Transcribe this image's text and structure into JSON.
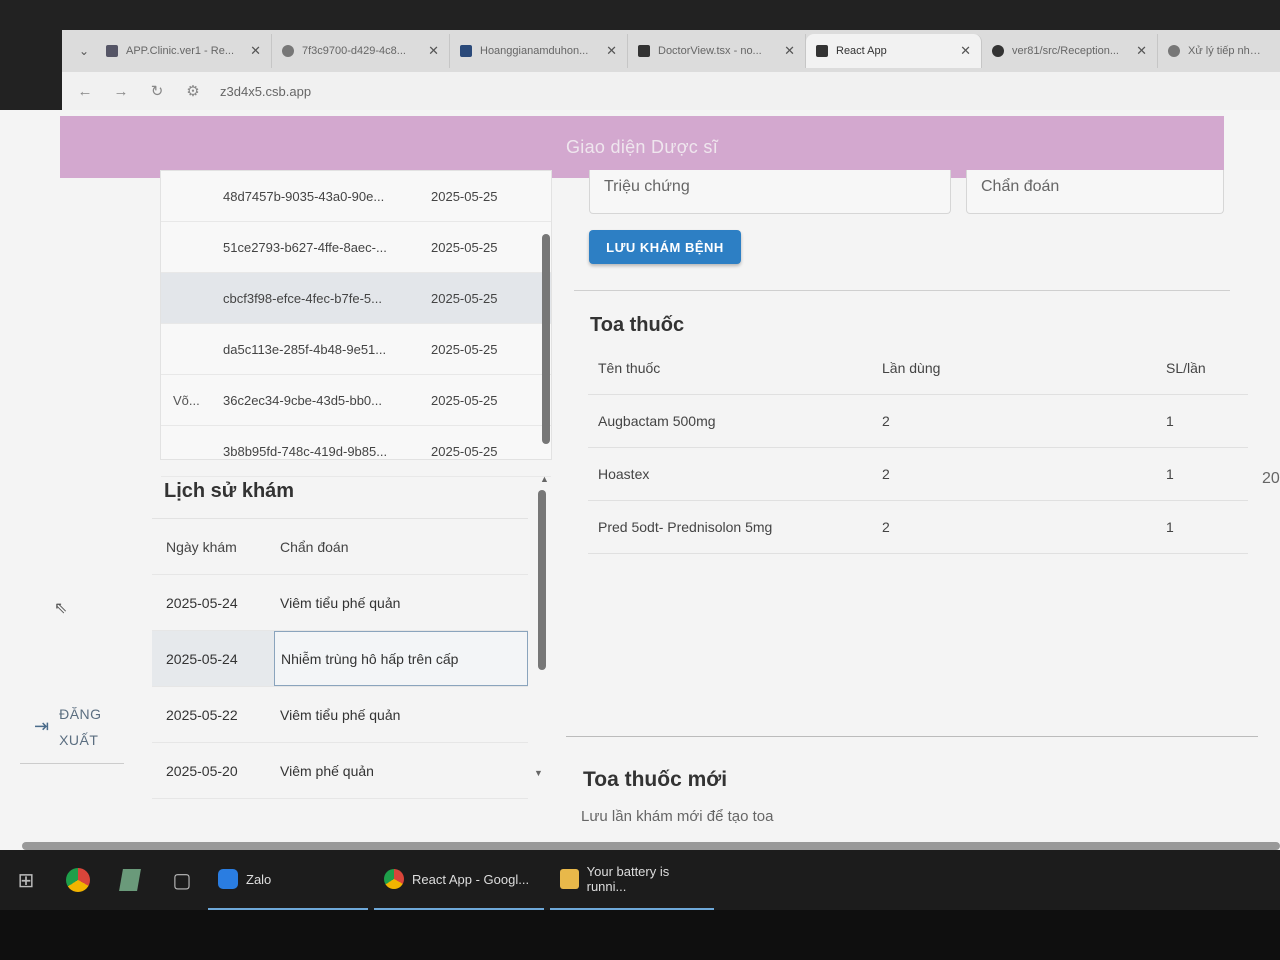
{
  "browser": {
    "tabs": [
      {
        "title": "APP.Clinic.ver1 - Re..."
      },
      {
        "title": "7f3c9700-d429-4c8..."
      },
      {
        "title": "Hoanggianamduhon..."
      },
      {
        "title": "DoctorView.tsx - no..."
      },
      {
        "title": "React App",
        "active": true
      },
      {
        "title": "ver81/src/Reception..."
      },
      {
        "title": "Xử lý tiếp nhận..."
      }
    ],
    "url": "z3d4x5.csb.app"
  },
  "header": {
    "title": "Giao diện Dược sĩ"
  },
  "sidebar": {
    "logout_label": "ĐĂNG XUẤT"
  },
  "visits": [
    {
      "name": "",
      "id": "48d7457b-9035-43a0-90e...",
      "date": "2025-05-25"
    },
    {
      "name": "",
      "id": "51ce2793-b627-4ffe-8aec-...",
      "date": "2025-05-25"
    },
    {
      "name": "",
      "id": "cbcf3f98-efce-4fec-b7fe-5...",
      "date": "2025-05-25",
      "selected": true
    },
    {
      "name": "",
      "id": "da5c113e-285f-4b48-9e51...",
      "date": "2025-05-25"
    },
    {
      "name": "Võ...",
      "id": "36c2ec34-9cbe-43d5-bb0...",
      "date": "2025-05-25"
    },
    {
      "name": "",
      "id": "3b8b95fd-748c-419d-9b85...",
      "date": "2025-05-25"
    }
  ],
  "history": {
    "title": "Lịch sử khám",
    "headers": {
      "date": "Ngày khám",
      "diagnosis": "Chẩn đoán"
    },
    "rows": [
      {
        "date": "2025-05-24",
        "diagnosis": "Viêm tiểu phế quản"
      },
      {
        "date": "2025-05-24",
        "diagnosis": "Nhiễm trùng hô hấp trên cấp",
        "selected": true
      },
      {
        "date": "2025-05-22",
        "diagnosis": "Viêm tiểu phế quản"
      },
      {
        "date": "2025-05-20",
        "diagnosis": "Viêm phế quản"
      }
    ]
  },
  "form": {
    "symptoms_label": "Triệu chứng",
    "diagnosis_label": "Chẩn đoán",
    "save_button": "LƯU KHÁM BỆNH"
  },
  "prescription": {
    "title": "Toa thuốc",
    "headers": {
      "name": "Tên thuốc",
      "times": "Lần dùng",
      "qty": "SL/lần"
    },
    "rows": [
      {
        "name": "Augbactam 500mg",
        "times": "2",
        "qty": "1"
      },
      {
        "name": "Hoastex",
        "times": "2",
        "qty": "1"
      },
      {
        "name": "Pred 5odt- Prednisolon 5mg",
        "times": "2",
        "qty": "1"
      }
    ],
    "stray_text": "20"
  },
  "new_prescription": {
    "title": "Toa thuốc mới",
    "subtitle": "Lưu lần khám mới để tạo toa"
  },
  "taskbar": {
    "zalo": "Zalo",
    "chrome": "React App - Googl...",
    "explorer": "Your battery is runni..."
  },
  "colors": {
    "header": "#d3a8cf",
    "button": "#2d7fc4"
  }
}
